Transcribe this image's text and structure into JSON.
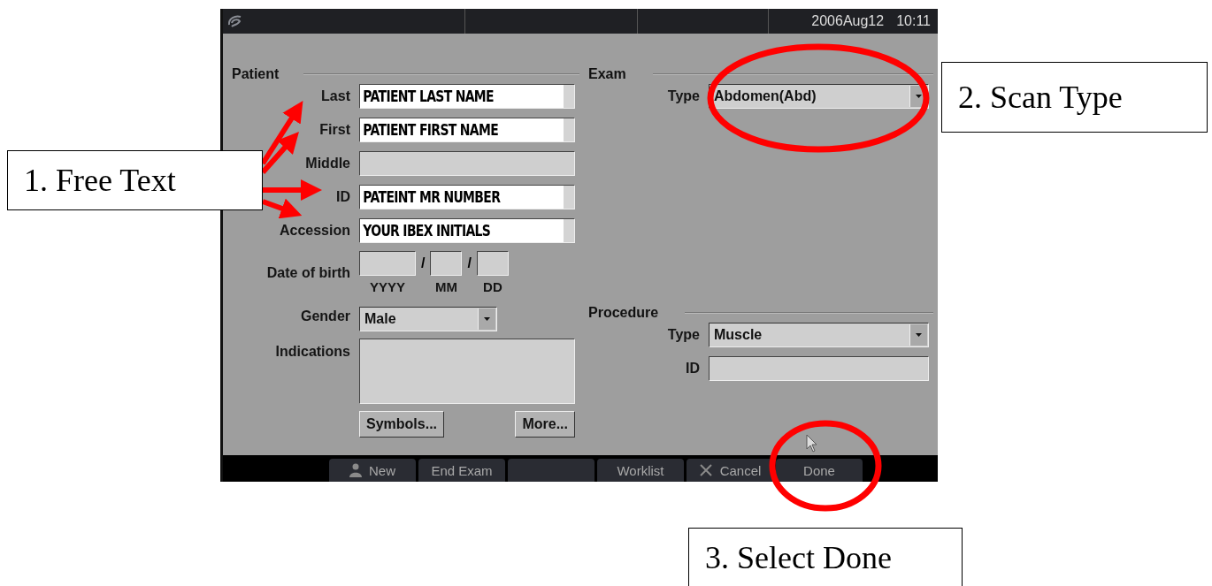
{
  "status_bar": {
    "date": "2006Aug12",
    "time": "10:11"
  },
  "patient": {
    "heading": "Patient",
    "fields": [
      {
        "label": "Last",
        "value": "PATIENT LAST NAME"
      },
      {
        "label": "First",
        "value": "PATIENT FIRST NAME"
      },
      {
        "label": "Middle"
      },
      {
        "label": "ID",
        "value": "PATEINT MR NUMBER"
      },
      {
        "label": "Accession",
        "value": "YOUR IBEX INITIALS"
      }
    ],
    "date_of_birth": {
      "label": "Date of birth",
      "parts": [
        {
          "caption": "YYYY"
        },
        {
          "caption": "MM",
          "separator": "/"
        },
        {
          "caption": "DD",
          "separator": "/"
        }
      ]
    },
    "gender": {
      "label": "Gender",
      "value": "Male"
    },
    "indications": {
      "label": "Indications"
    },
    "buttons": [
      "Symbols...",
      "More..."
    ]
  },
  "exam": {
    "heading": "Exam",
    "type": {
      "label": "Type",
      "value": "Abdomen(Abd)"
    }
  },
  "procedure": {
    "heading": "Procedure",
    "type": {
      "label": "Type",
      "value": "Muscle"
    },
    "id": {
      "label": "ID"
    }
  },
  "bottom_bar": [
    {
      "kind": "person",
      "label": "New"
    },
    {
      "kind": "plain",
      "label": "End Exam"
    },
    {
      "kind": "blank"
    },
    {
      "kind": "plain",
      "label": "Worklist"
    },
    {
      "kind": "cross",
      "label": "Cancel"
    },
    {
      "kind": "plain",
      "label": "Done"
    }
  ],
  "annotations": [
    {
      "text": "1. Free Text"
    },
    {
      "text": "2. Scan Type"
    },
    {
      "text": "3. Select Done"
    }
  ]
}
